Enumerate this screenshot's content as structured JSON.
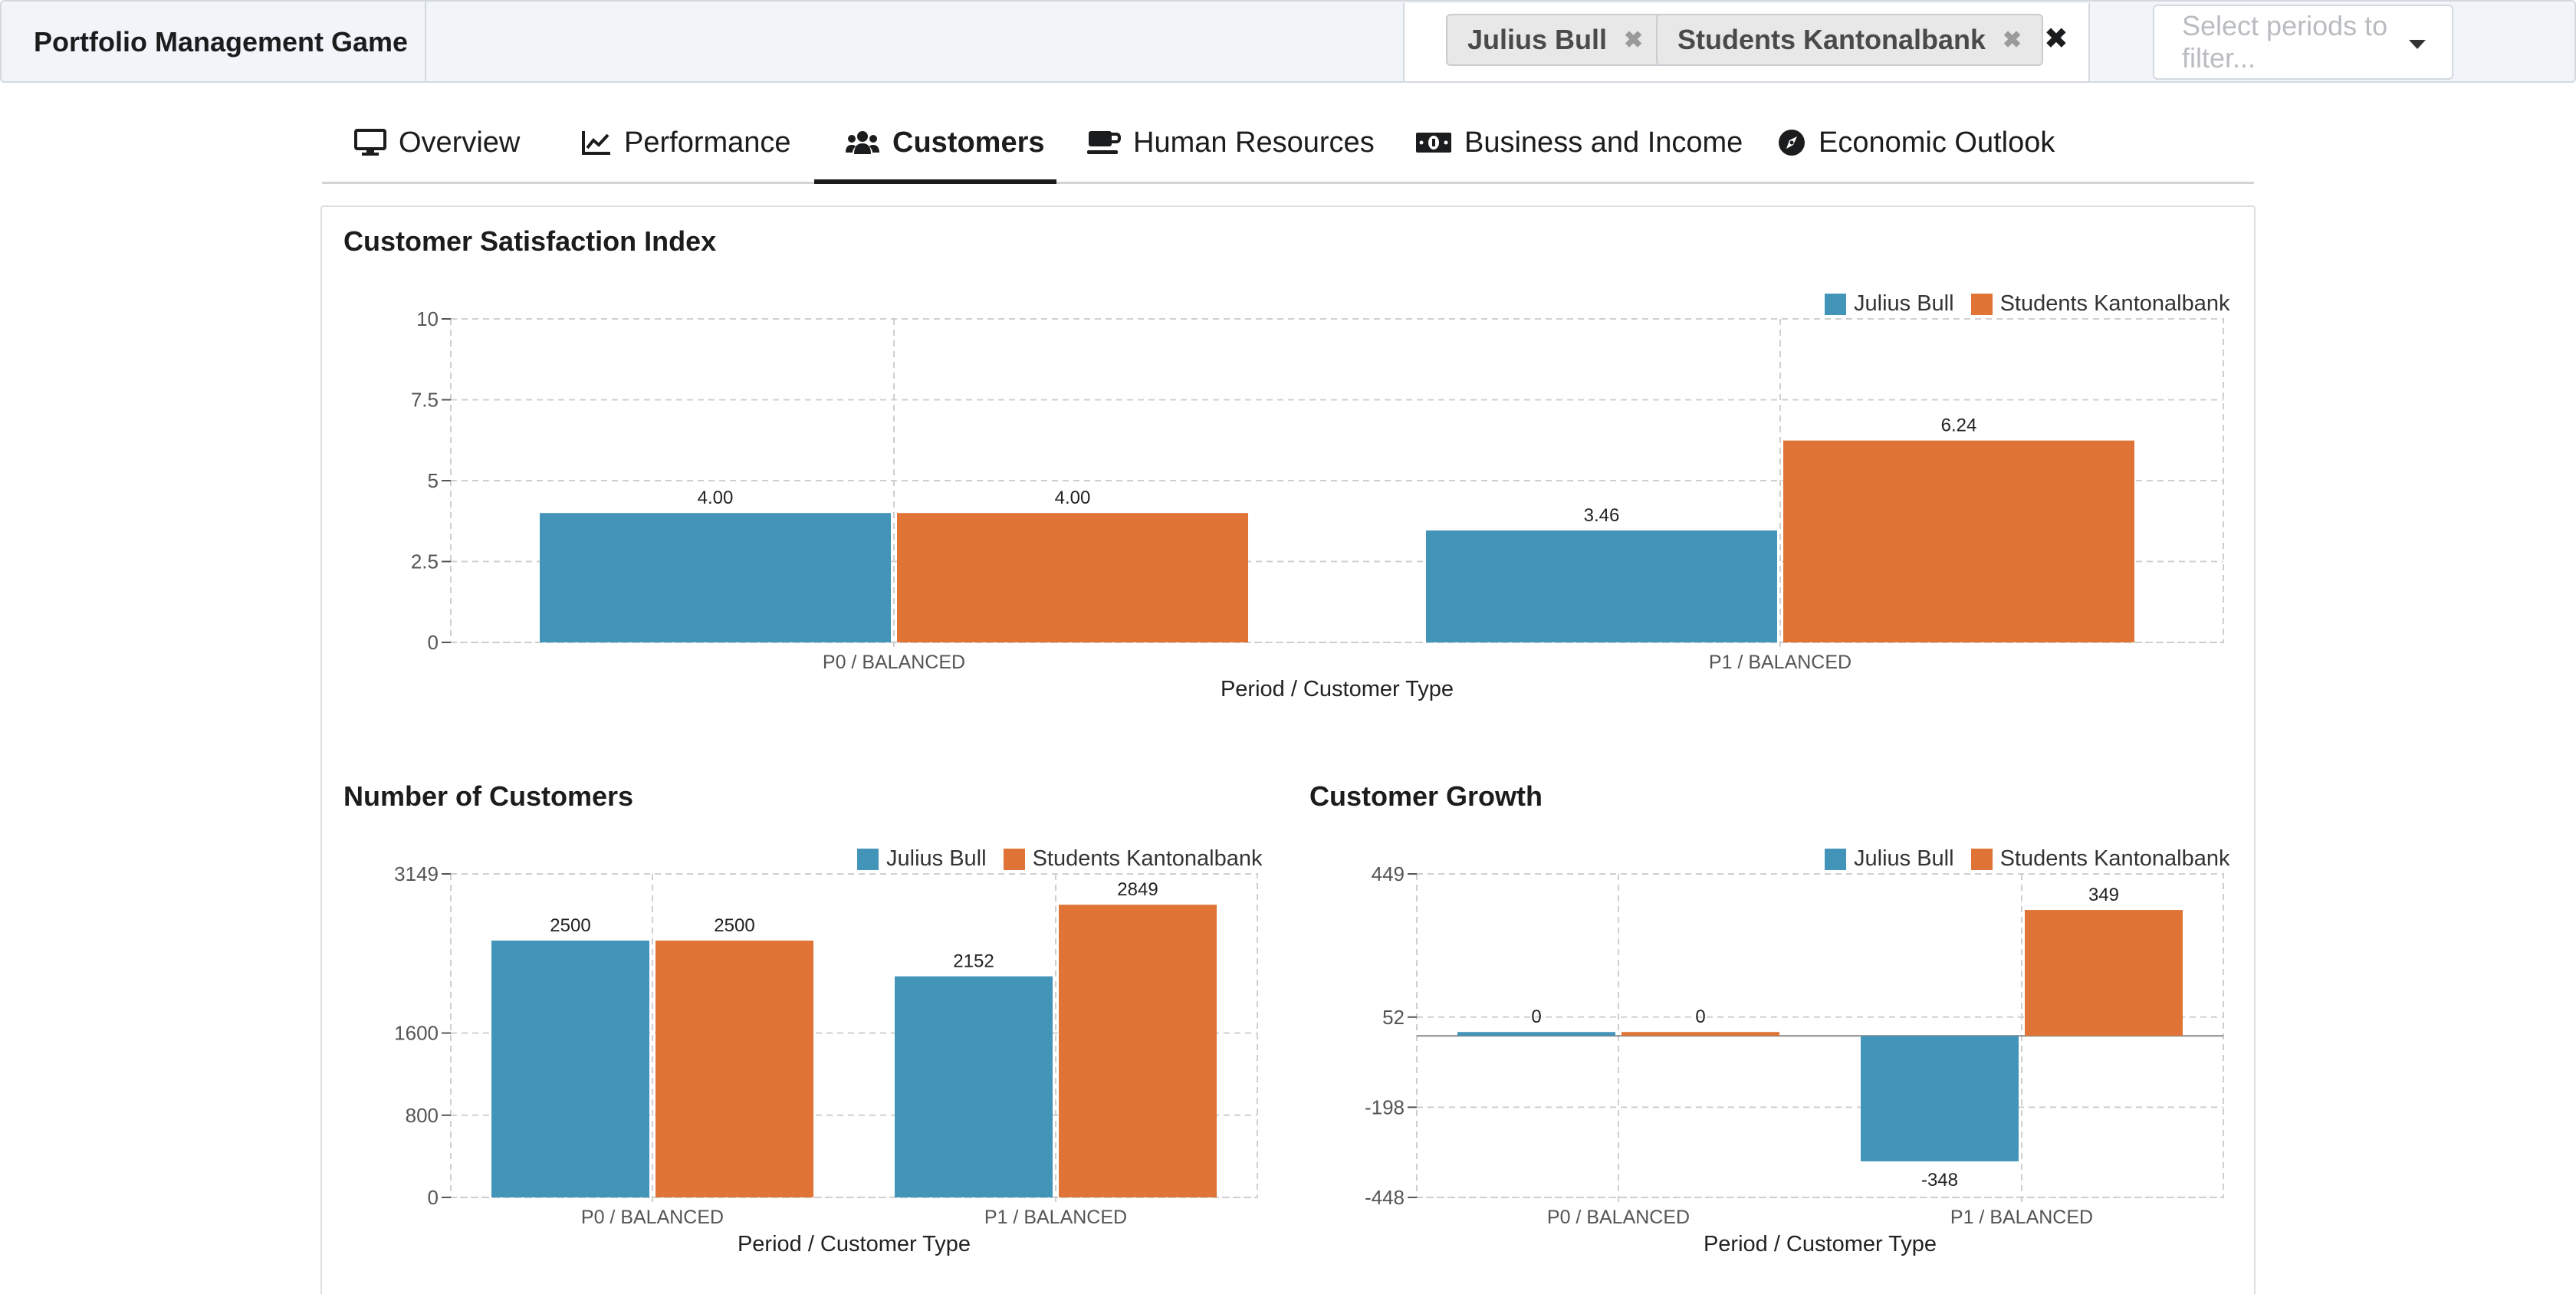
{
  "app": {
    "title": "Portfolio Management Game"
  },
  "filters": {
    "tags": [
      {
        "label": "Julius Bull"
      },
      {
        "label": "Students Kantonalbank"
      }
    ],
    "period_placeholder": "Select periods to filter..."
  },
  "tabs": [
    {
      "label": "Overview",
      "icon": "desktop-icon"
    },
    {
      "label": "Performance",
      "icon": "line-chart-icon"
    },
    {
      "label": "Customers",
      "icon": "users-icon",
      "active": true
    },
    {
      "label": "Human Resources",
      "icon": "coffee-icon"
    },
    {
      "label": "Business and Income",
      "icon": "money-bill-icon"
    },
    {
      "label": "Economic Outlook",
      "icon": "compass-icon"
    }
  ],
  "colors": {
    "julius": "#4394b9",
    "students": "#e07336",
    "grid": "#cfcfcf",
    "axis": "#555555"
  },
  "chart_data": [
    {
      "id": "satisfaction",
      "type": "bar",
      "title": "Customer Satisfaction Index",
      "xlabel": "Period / Customer Type",
      "ylabel": "",
      "categories": [
        "P0 / BALANCED",
        "P1 / BALANCED"
      ],
      "series": [
        {
          "name": "Julius Bull",
          "values": [
            4.0,
            3.46
          ],
          "labels": [
            "4.00",
            "3.46"
          ]
        },
        {
          "name": "Students Kantonalbank",
          "values": [
            4.0,
            6.24
          ],
          "labels": [
            "4.00",
            "6.24"
          ]
        }
      ],
      "ylim": [
        0,
        10
      ],
      "yticks": [
        0,
        2.5,
        5,
        7.5,
        10
      ],
      "ytick_labels": [
        "0",
        "2.5",
        "5",
        "7.5",
        "10"
      ],
      "grid": true,
      "legend": "top-right"
    },
    {
      "id": "customers",
      "type": "bar",
      "title": "Number of Customers",
      "xlabel": "Period / Customer Type",
      "ylabel": "",
      "categories": [
        "P0 / BALANCED",
        "P1 / BALANCED"
      ],
      "series": [
        {
          "name": "Julius Bull",
          "values": [
            2500,
            2152
          ],
          "labels": [
            "2500",
            "2152"
          ]
        },
        {
          "name": "Students Kantonalbank",
          "values": [
            2500,
            2849
          ],
          "labels": [
            "2500",
            "2849"
          ]
        }
      ],
      "ylim": [
        0,
        3149
      ],
      "yticks": [
        0,
        800,
        1600,
        3149
      ],
      "ytick_labels": [
        "0",
        "800",
        "1600",
        "3149"
      ],
      "grid": true,
      "legend": "top-right"
    },
    {
      "id": "growth",
      "type": "bar",
      "title": "Customer Growth",
      "xlabel": "Period / Customer Type",
      "ylabel": "",
      "categories": [
        "P0 / BALANCED",
        "P1 / BALANCED"
      ],
      "series": [
        {
          "name": "Julius Bull",
          "values": [
            0,
            -348
          ],
          "labels": [
            "0",
            "-348"
          ]
        },
        {
          "name": "Students Kantonalbank",
          "values": [
            0,
            349
          ],
          "labels": [
            "0",
            "349"
          ]
        }
      ],
      "ylim": [
        -448,
        449
      ],
      "yticks": [
        -448,
        -198,
        52,
        449
      ],
      "ytick_labels": [
        "-448",
        "-198",
        "52",
        "449"
      ],
      "grid": true,
      "legend": "top-right"
    }
  ]
}
